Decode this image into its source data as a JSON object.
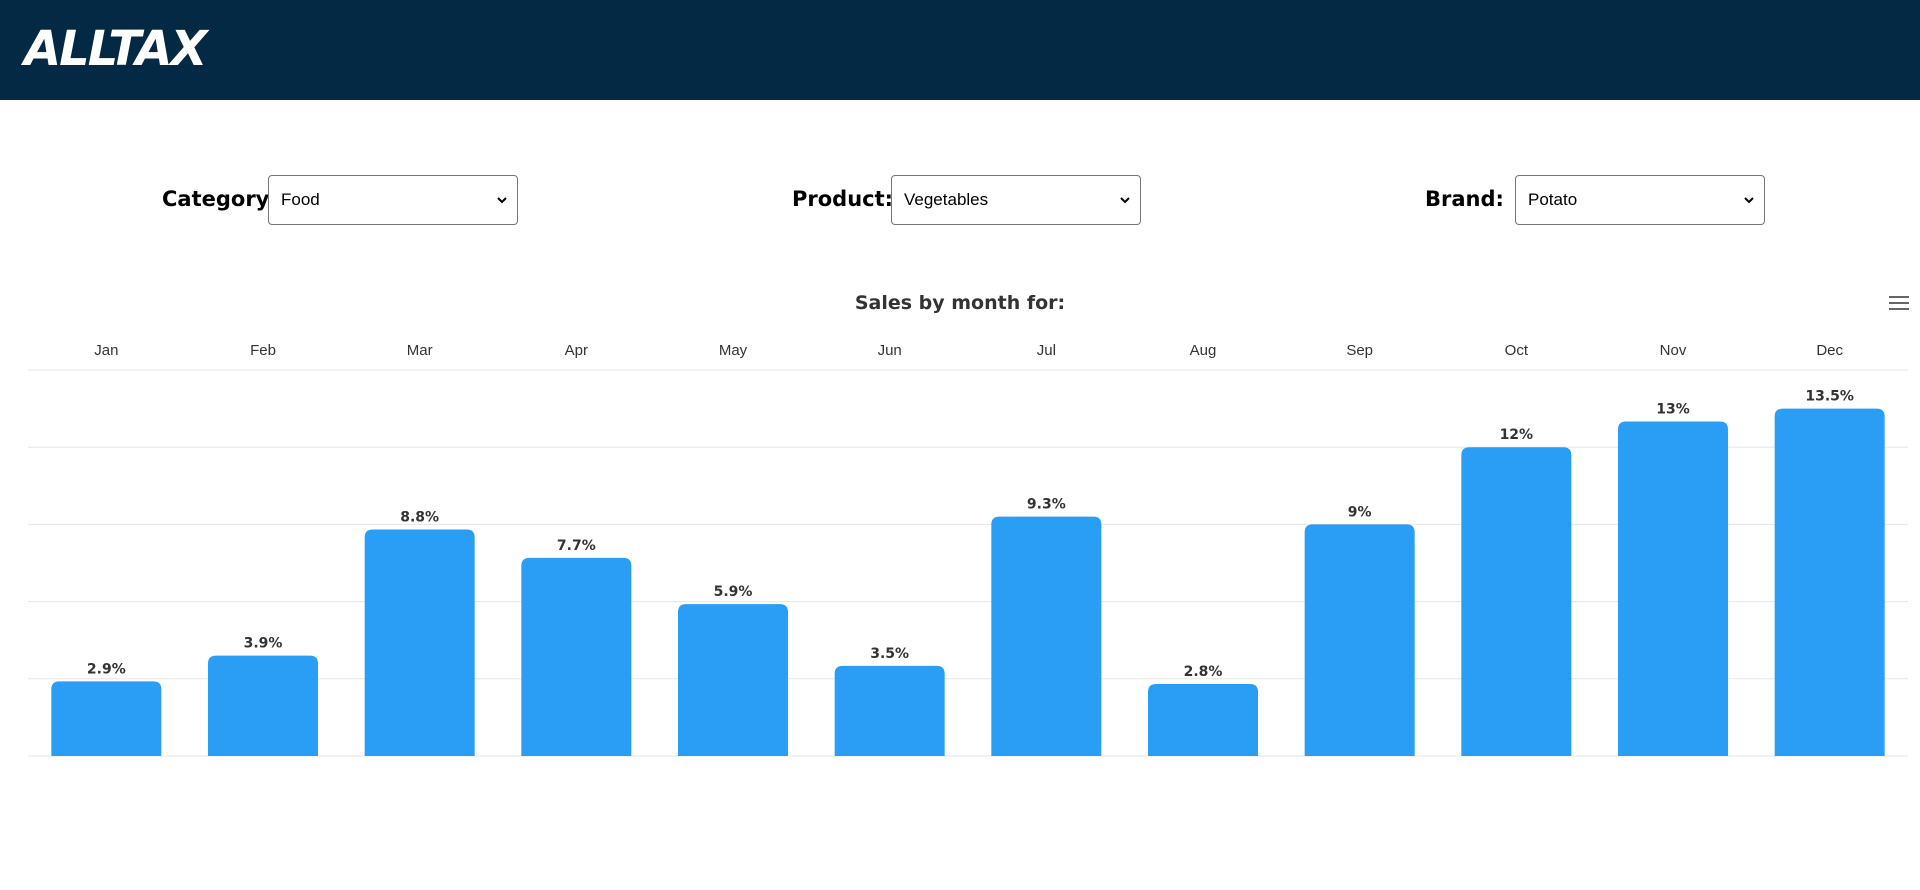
{
  "header": {
    "logo_text": "ALLTAX",
    "background_color": "#032944"
  },
  "filters": {
    "category": {
      "label": "Category:",
      "value": "Food"
    },
    "product": {
      "label": "Product:",
      "value": "Vegetables"
    },
    "brand": {
      "label": "Brand:",
      "value": "Potato"
    }
  },
  "chart_data": {
    "type": "bar",
    "title": "Sales by month for:",
    "categories": [
      "Jan",
      "Feb",
      "Mar",
      "Apr",
      "May",
      "Jun",
      "Jul",
      "Aug",
      "Sep",
      "Oct",
      "Nov",
      "Dec"
    ],
    "values": [
      2.9,
      3.9,
      8.8,
      7.7,
      5.9,
      3.5,
      9.3,
      2.8,
      9,
      12,
      13,
      13.5
    ],
    "data_labels": [
      "2.9%",
      "3.9%",
      "8.8%",
      "7.7%",
      "5.9%",
      "3.5%",
      "9.3%",
      "2.8%",
      "9%",
      "12%",
      "13%",
      "13.5%"
    ],
    "ylim": [
      0,
      15
    ],
    "category_axis_position": "top",
    "grid": true,
    "bar_color": "#2a9df4"
  },
  "chart_menu_icon": "hamburger-menu-icon"
}
